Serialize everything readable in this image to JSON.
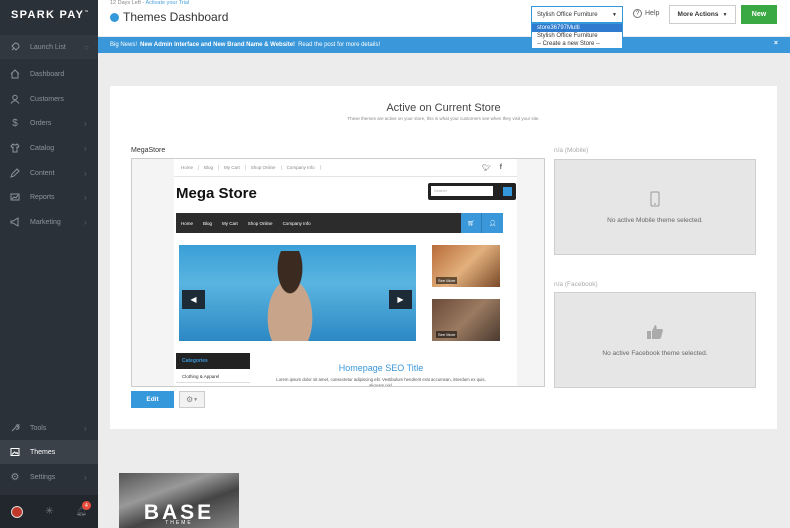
{
  "brand": {
    "name": "SPARK PAY",
    "tm": "™"
  },
  "sidebar": {
    "items": [
      {
        "label": "Launch List",
        "icon": "rocket-icon"
      },
      {
        "label": "Dashboard",
        "icon": "home-icon"
      },
      {
        "label": "Customers",
        "icon": "user-icon"
      },
      {
        "label": "Orders",
        "icon": "dollar-icon"
      },
      {
        "label": "Catalog",
        "icon": "shirt-icon"
      },
      {
        "label": "Content",
        "icon": "pen-icon"
      },
      {
        "label": "Reports",
        "icon": "chart-icon"
      },
      {
        "label": "Marketing",
        "icon": "megaphone-icon"
      },
      {
        "label": "Tools",
        "icon": "wrench-icon"
      },
      {
        "label": "Themes",
        "icon": "image-icon"
      },
      {
        "label": "Settings",
        "icon": "gear-icon"
      }
    ],
    "notification_count": "4"
  },
  "header": {
    "trial_text": "12 Days Left",
    "trial_link": "Activate your Trial",
    "title": "Themes Dashboard",
    "store_select": "Stylish Office Furniture",
    "store_options": [
      "store36797Multi",
      "Stylish Office Furniture",
      "-- Create a new Store --"
    ],
    "help_label": "Help",
    "more_actions_label": "More Actions",
    "new_label": "New"
  },
  "announcement": {
    "lead": "Big News!",
    "headline": "New Admin Interface and New Brand Name & Website!",
    "rest": "Read the post for more details!",
    "close": "×"
  },
  "active_section": {
    "title": "Active on Current Store",
    "subtitle": "These themes are active on your store, this is what your customers see when they visit your site.",
    "theme_name": "MegaStore",
    "edit_label": "Edit",
    "mobile_label": "n/a (Mobile)",
    "mobile_empty": "No active Mobile theme selected.",
    "facebook_label": "n/a (Facebook)",
    "facebook_empty": "No active Facebook theme selected."
  },
  "preview": {
    "top_nav": [
      "Home",
      "Blog",
      "My Cart",
      "Shop Online",
      "Company Info"
    ],
    "logo": "Mega Store",
    "search_placeholder": "Search",
    "main_nav": [
      "Home",
      "Blog",
      "My Cart",
      "Shop Online",
      "Company Info"
    ],
    "see_more_1": "See More",
    "see_more_2": "See More",
    "categories_title": "Categories",
    "category_1": "Clothing & Apparel",
    "seo_title": "Homepage SEO Title",
    "seo_text": "Lorem ipsum dolor sit amet, consectetur adipiscing elit. Vestibulum hendrerit erat accumsan, interdum ex quis, aliquam nisl."
  },
  "other_theme": {
    "name": "BASE",
    "sub": "THEME"
  }
}
